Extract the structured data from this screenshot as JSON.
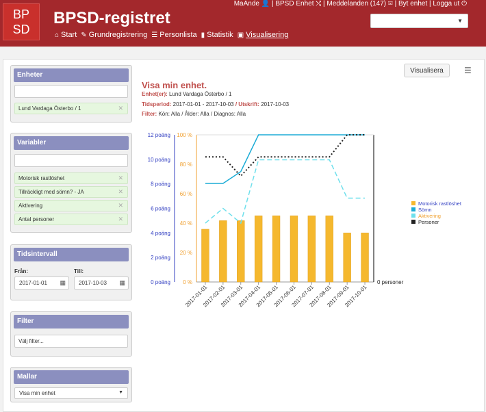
{
  "app": {
    "logo_text_line1": "BP",
    "logo_text_line2": "SD",
    "title": "BPSD-registret",
    "top_links": "MaAnde 👤 | BPSD Enhet ⤭ | Meddelanden (147) ✉ | Byt enhet | Logga ut ⏻",
    "unit_select_value": ""
  },
  "nav": [
    {
      "label": "Start",
      "icon": "home-icon",
      "glyph": "⌂"
    },
    {
      "label": "Grundregistrering",
      "icon": "edit-icon",
      "glyph": "✎"
    },
    {
      "label": "Personlista",
      "icon": "list-icon",
      "glyph": "☰"
    },
    {
      "label": "Statistik",
      "icon": "file-icon",
      "glyph": "▮"
    },
    {
      "label": "Visualisering",
      "icon": "image-icon",
      "glyph": "▣"
    }
  ],
  "panels": {
    "enheter": {
      "title": "Enheter",
      "input_value": "",
      "tags": [
        "Lund Vardaga Österbo / 1"
      ]
    },
    "variabler": {
      "title": "Variabler",
      "input_value": "",
      "tags": [
        "Motorisk rastlöshet",
        "Tillräckligt med sömn? - JA",
        "Aktivering",
        "Antal personer"
      ]
    },
    "tidsintervall": {
      "title": "Tidsintervall",
      "from_label": "Från:",
      "from_value": "2017-01-01",
      "to_label": "Till:",
      "to_value": "2017-10-03"
    },
    "filter": {
      "title": "Filter",
      "placeholder": "Välj filter..."
    },
    "mallar": {
      "title": "Mallar",
      "selected": "Visa min enhet"
    }
  },
  "visual": {
    "button": "Visualisera",
    "title": "Visa min enhet.",
    "enheter_label": "Enhet(er):",
    "enheter_value": "Lund Vardaga Österbo / 1",
    "period_label": "Tidsperiod:",
    "period_value": "2017-01-01 - 2017-10-03",
    "utskrift_label": "/ Utskrift:",
    "utskrift_value": "2017-10-03",
    "filter_label": "Filter:",
    "filter_value": "Kön: Alla / Ålder: Alla / Diagnos: Alla"
  },
  "colors": {
    "header": "#a3282c",
    "panel_head": "#8b8fbf",
    "bar": "#f5b82e",
    "somn": "#1bacd6",
    "aktivering": "#6fe0ec",
    "personer": "#222222",
    "poang_axis": "#3340c2",
    "percent_axis": "#f0a030"
  },
  "chart_data": {
    "type": "bar",
    "categories": [
      "2017-01-01",
      "2017-02-01",
      "2017-03-01",
      "2017-04-01",
      "2017-05-01",
      "2017-06-01",
      "2017-07-01",
      "2017-08-01",
      "2017-09-01",
      "2017-10-01"
    ],
    "series": [
      {
        "name": "Motorisk rastlöshet",
        "type": "bar",
        "axis": "poang",
        "values": [
          4.3,
          5.0,
          5.0,
          5.4,
          5.4,
          5.4,
          5.4,
          5.4,
          4.0,
          4.0
        ]
      },
      {
        "name": "Sömn",
        "type": "line",
        "axis": "percent",
        "values": [
          67,
          67,
          75,
          100,
          100,
          100,
          100,
          100,
          100,
          100
        ]
      },
      {
        "name": "Aktivering",
        "type": "line",
        "axis": "percent",
        "values": [
          40,
          50,
          40,
          83,
          83,
          83,
          83,
          83,
          57,
          57
        ]
      },
      {
        "name": "Personer",
        "type": "line",
        "axis": "personer",
        "values": [
          null,
          null,
          null,
          null,
          null,
          null,
          null,
          null,
          null,
          null
        ]
      }
    ],
    "left_axis_ticks": [
      "0 poäng",
      "2 poäng",
      "4 poäng",
      "6 poäng",
      "8 poäng",
      "10 poäng",
      "12 poäng"
    ],
    "left_axis_range": [
      0,
      12
    ],
    "percent_ticks": [
      "0 %",
      "20 %",
      "40 %",
      "60 %",
      "80 %",
      "100 %"
    ],
    "percent_range": [
      0,
      100
    ],
    "right_axis_label": "0 personer",
    "legend": [
      "Motorisk rastlöshet",
      "Sömn",
      "Aktivering",
      "Personer"
    ],
    "legend_position": "right"
  }
}
